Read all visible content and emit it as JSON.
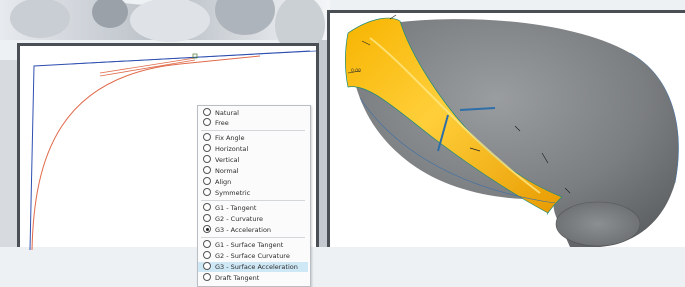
{
  "menu": {
    "items": [
      {
        "label": "Natural",
        "checked": false
      },
      {
        "label": "Free",
        "checked": false
      },
      {
        "label": "Fix Angle",
        "checked": false
      },
      {
        "label": "Horizontal",
        "checked": false
      },
      {
        "label": "Vertical",
        "checked": false
      },
      {
        "label": "Normal",
        "checked": false
      },
      {
        "label": "Align",
        "checked": false
      },
      {
        "label": "Symmetric",
        "checked": false
      },
      {
        "label": "G1 - Tangent",
        "checked": false
      },
      {
        "label": "G2 - Curvature",
        "checked": false
      },
      {
        "label": "G3 - Acceleration",
        "checked": true
      },
      {
        "label": "G1 - Surface Tangent",
        "checked": false
      },
      {
        "label": "G2 - Surface Curvature",
        "checked": false
      },
      {
        "label": "G3 - Surface Acceleration",
        "checked": false,
        "highlighted": true
      },
      {
        "label": "Draft Tangent",
        "checked": false
      }
    ]
  },
  "viewport": {
    "dimension_label": "0.00",
    "colors": {
      "surface_highlight": "#f5a800",
      "body_gray": "#7a7d80",
      "curve_blue": "#2e4fb0",
      "curve_red": "#e06a4a",
      "selection_blue": "#cfe8f6"
    }
  }
}
